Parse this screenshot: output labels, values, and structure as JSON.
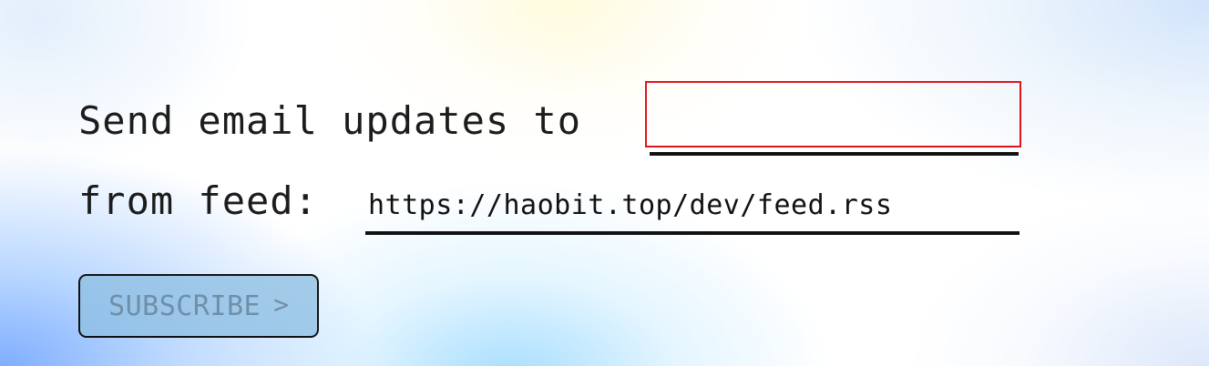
{
  "form": {
    "email_label": "Send email updates to",
    "email_value": "",
    "email_placeholder": "",
    "feed_label": "from feed:",
    "feed_value": "https://haobit.top/dev/feed.rss",
    "subscribe_label": "SUBSCRIBE",
    "subscribe_icon": "chevron-right-icon",
    "subscribe_icon_glyph": ">",
    "subscribe_disabled": true
  },
  "colors": {
    "email_focus_border": "#e0141c",
    "underline": "#111111",
    "text": "#1c1c1c",
    "button_bg": "#8cbee1",
    "button_text": "#6f8fa8"
  }
}
